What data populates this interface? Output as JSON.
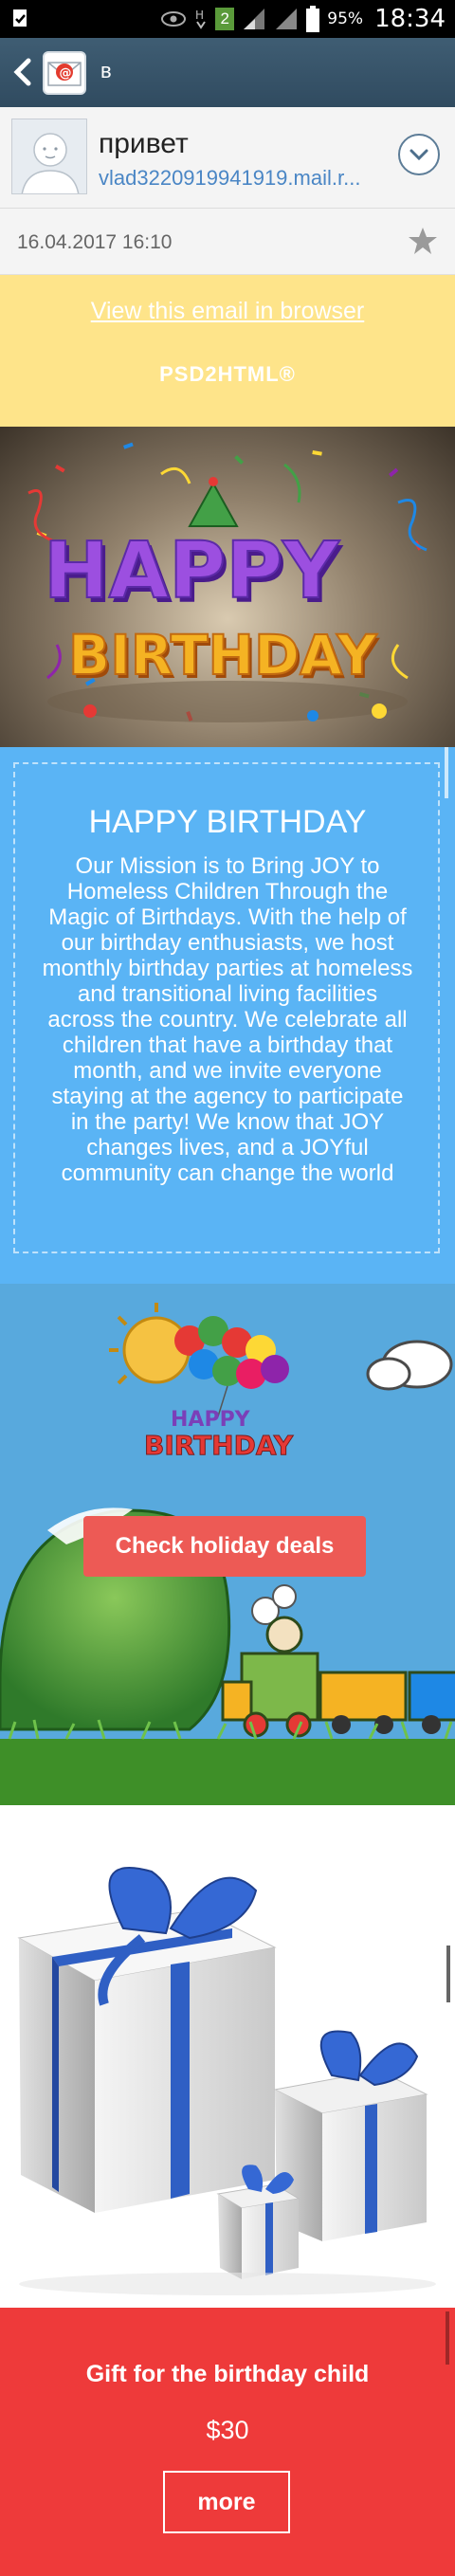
{
  "status_bar": {
    "time": "18:34",
    "battery": "95%",
    "signal_badge": "2",
    "network": "H"
  },
  "app_bar": {
    "title": "в"
  },
  "message": {
    "sender_name": "привет",
    "sender_email": "vlad3220919941919.mail.r...",
    "date": "16.04.2017  16:10"
  },
  "email": {
    "view_in_browser": "View this email in browser",
    "logo": "PSD2HTML®",
    "hero_text": "HAPPY BIRTHDAY",
    "intro": {
      "title": "HAPPY BIRTHDAY",
      "body": "Our Mission is to Bring JOY to Homeless Children Through the Magic of Birthdays. With the help of our birthday enthusiasts, we host monthly birthday parties at homeless and transitional living facilities across the country. We celebrate all children that have a birthday that month, and we invite everyone staying at the agency to participate in the party! We know that JOY changes lives, and a JOYful community can change the world"
    },
    "party": {
      "badge_text": "HAPPY BIRTHDAY",
      "button_label": "Check holiday deals"
    },
    "gift": {
      "title": "Gift for the birthday child",
      "price": "$30",
      "more_label": "more"
    }
  },
  "colors": {
    "appbar": "#304b60",
    "header_yellow": "#fee48a",
    "intro_blue": "#5ab4f5",
    "deals_button": "#ed5a55",
    "gift_red": "#ee3a3a"
  }
}
